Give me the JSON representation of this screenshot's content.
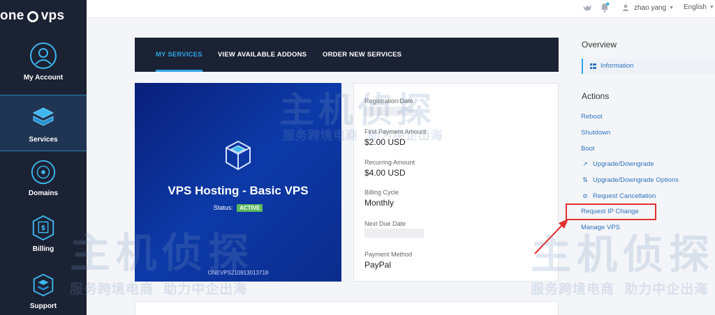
{
  "app": {
    "logo_left": "one",
    "logo_right": "vps"
  },
  "sidebar": {
    "items": [
      {
        "label": "My Account",
        "icon": "user-circle-icon"
      },
      {
        "label": "Services",
        "icon": "box-stack-icon",
        "active": true
      },
      {
        "label": "Domains",
        "icon": "globe-icon"
      },
      {
        "label": "Billing",
        "icon": "invoice-icon"
      },
      {
        "label": "Support",
        "icon": "support-stack-icon"
      }
    ]
  },
  "topbar": {
    "user_name": "zhao yang",
    "language": "English"
  },
  "tabs": [
    {
      "label": "MY SERVICES",
      "active": true
    },
    {
      "label": "VIEW AVAILABLE ADDONS"
    },
    {
      "label": "ORDER NEW SERVICES"
    }
  ],
  "service": {
    "title": "VPS Hosting - Basic VPS",
    "status_label": "Status:",
    "status": "ACTIVE",
    "service_id": "ONEVPS210913013718"
  },
  "details": [
    {
      "label": "Registration Date",
      "value": ""
    },
    {
      "label": "First Payment Amount",
      "value": "$2.00 USD"
    },
    {
      "label": "Recurring Amount",
      "value": "$4.00 USD"
    },
    {
      "label": "Billing Cycle",
      "value": "Monthly"
    },
    {
      "label": "Next Due Date",
      "value": ""
    },
    {
      "label": "Payment Method",
      "value": "PayPal"
    }
  ],
  "overview": {
    "heading": "Overview",
    "info_label": "Information"
  },
  "actions": {
    "heading": "Actions",
    "links": [
      {
        "label": "Reboot",
        "icon": ""
      },
      {
        "label": "Shutdown",
        "icon": ""
      },
      {
        "label": "Boot",
        "icon": ""
      },
      {
        "label": "Upgrade/Downgrade",
        "icon": "external-link-icon"
      },
      {
        "label": "Upgrade/Downgrade Options",
        "icon": "swap-arrows-icon"
      },
      {
        "label": "Request Cancellation",
        "icon": "ban-icon"
      },
      {
        "label": "Request IP Change",
        "icon": "",
        "highlighted": true
      },
      {
        "label": "Manage VPS",
        "icon": ""
      }
    ]
  },
  "watermark": {
    "brand": "主机侦探",
    "slogan_1": "服务跨境电商",
    "slogan_2": "助力中企出海"
  },
  "colors": {
    "sidebar_bg": "#1b2233",
    "accent": "#2fa4e7",
    "link": "#2f74c0",
    "status_active": "#5cb85c",
    "highlight": "#e33030"
  }
}
